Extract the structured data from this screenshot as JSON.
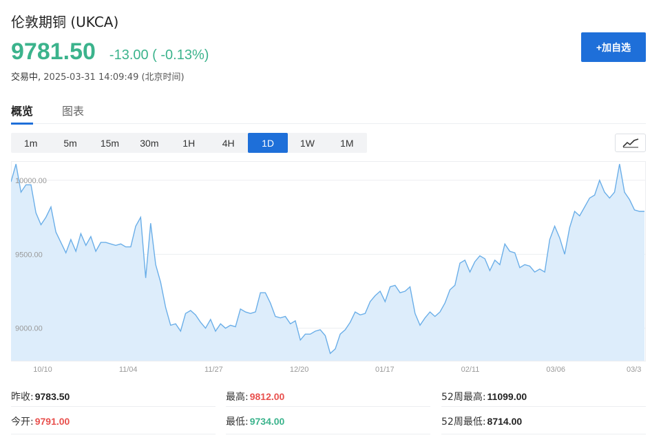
{
  "header": {
    "title": "伦敦期铜 (UKCA)",
    "price": "9781.50",
    "change": "-13.00 ( -0.13%)",
    "status_label": "交易中,",
    "timestamp": "2025-03-31 14:09:49 (北京时间)",
    "add_button": "+加自选"
  },
  "tabs": [
    {
      "label": "概览",
      "active": true
    },
    {
      "label": "图表",
      "active": false
    }
  ],
  "periods": [
    "1m",
    "5m",
    "15m",
    "30m",
    "1H",
    "4H",
    "1D",
    "1W",
    "1M"
  ],
  "active_period": "1D",
  "chart_toggle_icon": "line-chart-icon",
  "colors": {
    "up": "#e8504d",
    "down": "#3bb38c",
    "accent": "#1e6fd9",
    "line": "#6aaee8",
    "fill": "#ddedfb"
  },
  "chart_data": {
    "type": "area",
    "x_labels": [
      "10/10",
      "11/04",
      "11/27",
      "12/20",
      "01/17",
      "02/11",
      "03/06",
      "03/3"
    ],
    "y_ticks": [
      "10000.00",
      "9500.00",
      "9000.00"
    ],
    "ylim": [
      8780,
      10130
    ],
    "grid": true,
    "values": [
      9990,
      10110,
      9920,
      9970,
      9970,
      9780,
      9700,
      9750,
      9820,
      9650,
      9580,
      9510,
      9600,
      9520,
      9640,
      9560,
      9620,
      9520,
      9580,
      9580,
      9570,
      9560,
      9570,
      9550,
      9550,
      9690,
      9750,
      9340,
      9710,
      9430,
      9310,
      9140,
      9020,
      9030,
      8980,
      9100,
      9120,
      9090,
      9040,
      9000,
      9060,
      8980,
      9030,
      9000,
      9020,
      9010,
      9130,
      9110,
      9100,
      9110,
      9240,
      9240,
      9170,
      9080,
      9070,
      9080,
      9030,
      9050,
      8920,
      8960,
      8960,
      8980,
      8990,
      8950,
      8830,
      8860,
      8960,
      8990,
      9040,
      9110,
      9090,
      9100,
      9180,
      9220,
      9250,
      9180,
      9280,
      9290,
      9240,
      9250,
      9280,
      9100,
      9020,
      9070,
      9110,
      9080,
      9110,
      9170,
      9260,
      9290,
      9440,
      9460,
      9380,
      9450,
      9490,
      9470,
      9390,
      9460,
      9430,
      9570,
      9520,
      9510,
      9410,
      9430,
      9420,
      9380,
      9400,
      9380,
      9600,
      9690,
      9610,
      9500,
      9680,
      9790,
      9760,
      9820,
      9880,
      9900,
      10000,
      9920,
      9880,
      9920,
      10110,
      9920,
      9870,
      9800,
      9790,
      9790
    ]
  },
  "stats": [
    {
      "label": "昨收:",
      "value": "9783.50",
      "tone": "dark"
    },
    {
      "label": "最高:",
      "value": "9812.00",
      "tone": "red"
    },
    {
      "label": "52周最高:",
      "value": "11099.00",
      "tone": "dark"
    },
    {
      "label": "今开:",
      "value": "9791.00",
      "tone": "red"
    },
    {
      "label": "最低:",
      "value": "9734.00",
      "tone": "green"
    },
    {
      "label": "52周最低:",
      "value": "8714.00",
      "tone": "dark"
    }
  ]
}
